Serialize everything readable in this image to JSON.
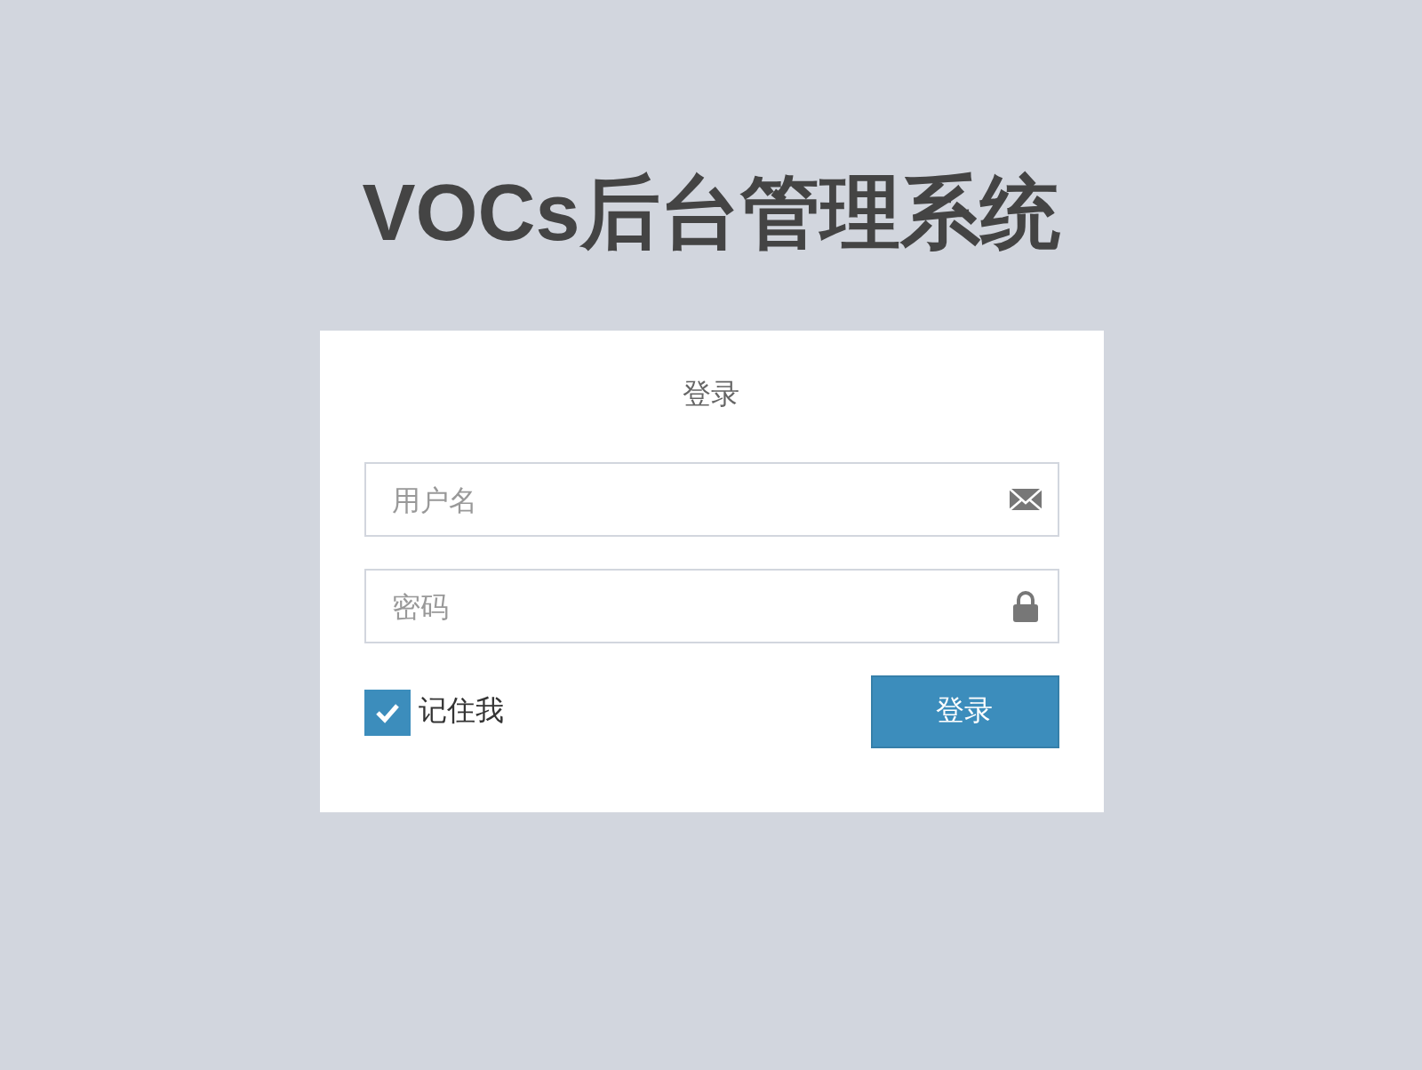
{
  "title": "VOCs后台管理系统",
  "login": {
    "heading": "登录",
    "fields": [
      {
        "placeholder": "用户名",
        "kind": "email"
      },
      {
        "placeholder": "密码",
        "kind": "lock"
      }
    ],
    "remember": {
      "label": "记住我",
      "checked": true
    },
    "submit": "登录"
  }
}
